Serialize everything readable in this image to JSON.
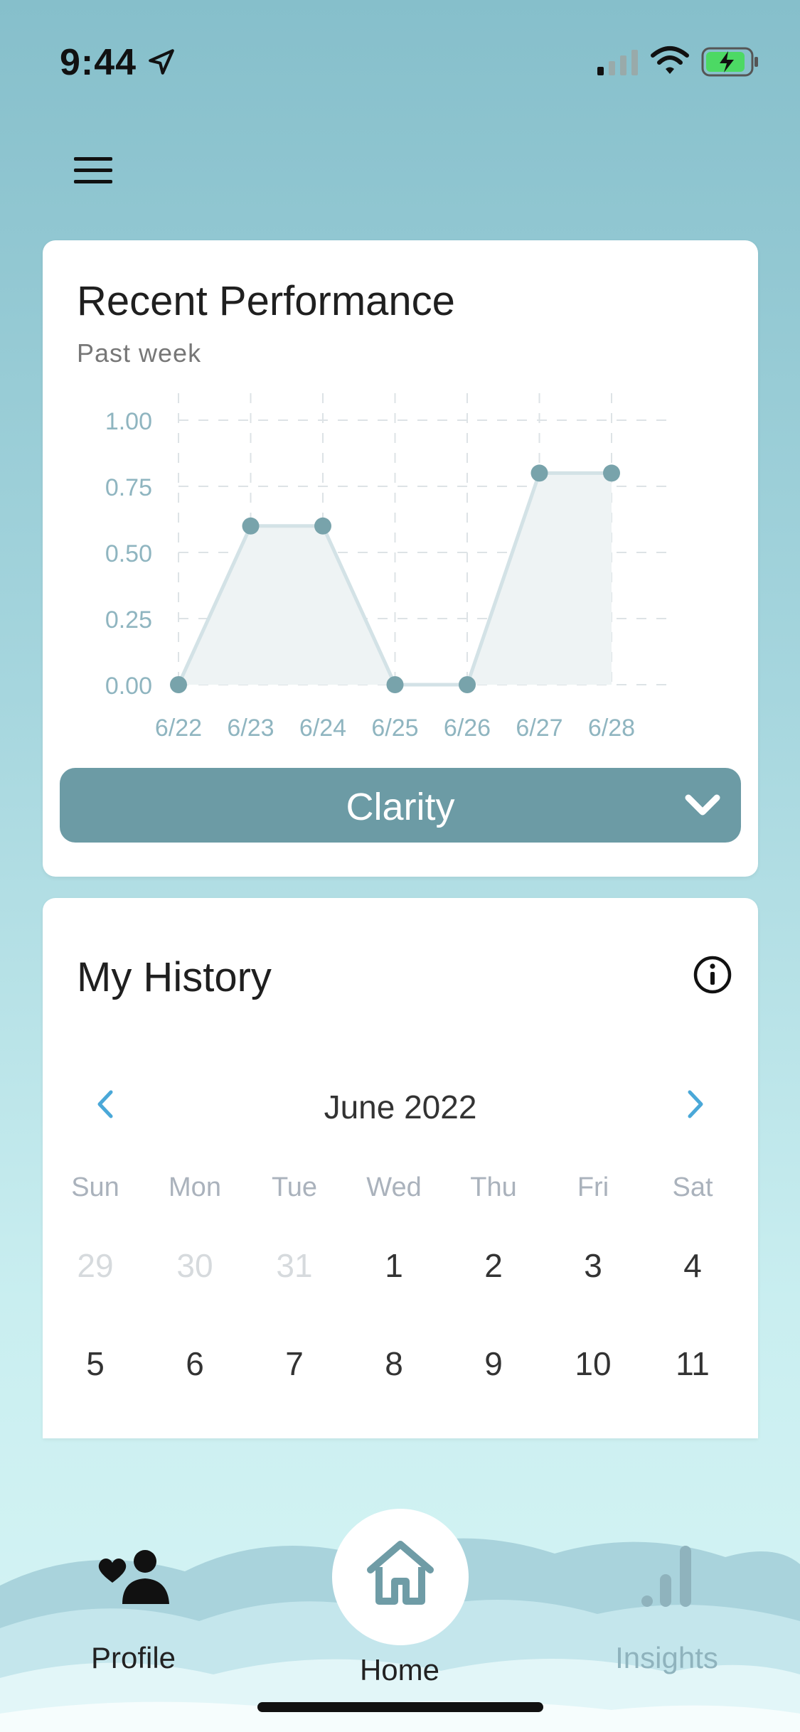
{
  "status_bar": {
    "time": "9:44",
    "icons": [
      "location-arrow-icon",
      "cellular-signal-icon",
      "wifi-icon",
      "battery-charging-icon"
    ],
    "battery_color": "#4cd964"
  },
  "header": {
    "menu_icon": "hamburger-menu-icon"
  },
  "performance": {
    "title": "Recent Performance",
    "subtitle": "Past week",
    "selected_metric": "Clarity",
    "chart_data": {
      "type": "area",
      "categories": [
        "6/22",
        "6/23",
        "6/24",
        "6/25",
        "6/26",
        "6/27",
        "6/28"
      ],
      "values": [
        0.0,
        0.6,
        0.6,
        0.0,
        0.0,
        0.8,
        0.8
      ],
      "ylim": [
        0,
        1
      ],
      "yticks": [
        "0.00",
        "0.25",
        "0.50",
        "0.75",
        "1.00"
      ],
      "grid": true,
      "line_color": "#d3e2e6",
      "fill_color": "#eef3f4",
      "point_color": "#78a3ab",
      "tick_color": "#8fb5c0"
    }
  },
  "history": {
    "title": "My History",
    "month": "June 2022",
    "weekdays": [
      "Sun",
      "Mon",
      "Tue",
      "Wed",
      "Thu",
      "Fri",
      "Sat"
    ],
    "weeks": [
      [
        {
          "d": "29",
          "muted": true
        },
        {
          "d": "30",
          "muted": true
        },
        {
          "d": "31",
          "muted": true
        },
        {
          "d": "1",
          "muted": false
        },
        {
          "d": "2",
          "muted": false
        },
        {
          "d": "3",
          "muted": false
        },
        {
          "d": "4",
          "muted": false
        }
      ],
      [
        {
          "d": "5",
          "muted": false
        },
        {
          "d": "6",
          "muted": false
        },
        {
          "d": "7",
          "muted": false
        },
        {
          "d": "8",
          "muted": false
        },
        {
          "d": "9",
          "muted": false
        },
        {
          "d": "10",
          "muted": false
        },
        {
          "d": "11",
          "muted": false
        }
      ]
    ],
    "accent_color": "#4aa8d8"
  },
  "nav": {
    "profile": "Profile",
    "home": "Home",
    "insights": "Insights",
    "active_color": "#6f9ca6",
    "inactive_color": "#8fb3bd"
  }
}
